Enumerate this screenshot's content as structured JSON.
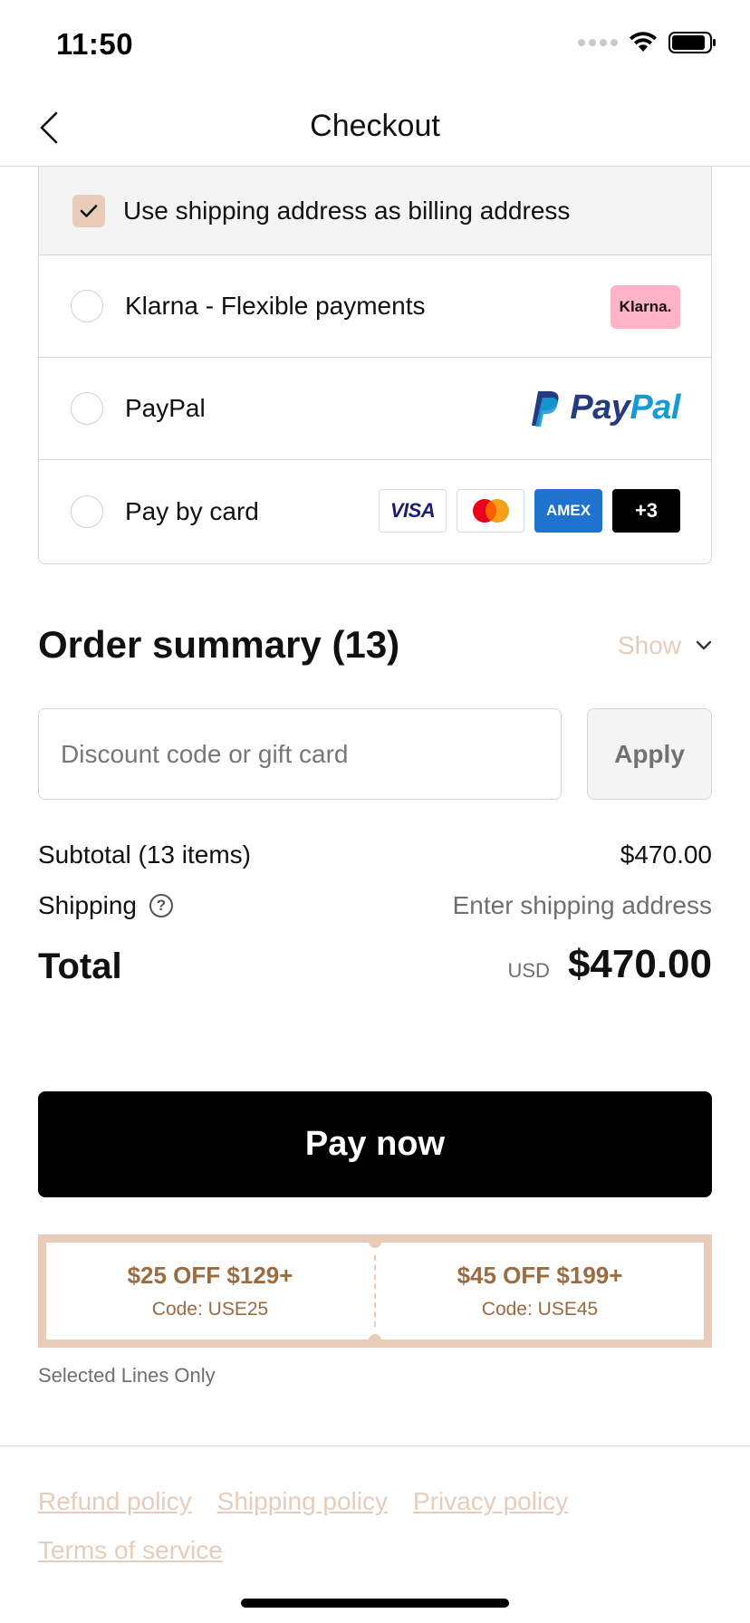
{
  "status_bar": {
    "time": "11:50"
  },
  "nav": {
    "title": "Checkout"
  },
  "payment": {
    "billing_label": "Use shipping address as billing address",
    "billing_checked": true,
    "options": [
      {
        "label": "Klarna - Flexible payments",
        "badge": "Klarna."
      },
      {
        "label": "PayPal",
        "logo_pay": "Pay",
        "logo_pal": "Pal"
      },
      {
        "label": "Pay by card",
        "cards": [
          "VISA",
          "mastercard",
          "AMEX",
          "+3"
        ]
      }
    ]
  },
  "summary": {
    "title": "Order summary (13)",
    "show_label": "Show",
    "discount_placeholder": "Discount code or gift card",
    "apply_label": "Apply",
    "subtotal_label": "Subtotal (13 items)",
    "subtotal_value": "$470.00",
    "shipping_label": "Shipping",
    "shipping_value": "Enter shipping address",
    "total_label": "Total",
    "currency": "USD",
    "total_value": "$470.00"
  },
  "pay_now_label": "Pay now",
  "coupons": [
    {
      "title": "$25 OFF $129+",
      "code": "Code: USE25"
    },
    {
      "title": "$45 OFF $199+",
      "code": "Code: USE45"
    }
  ],
  "coupon_note": "Selected Lines Only",
  "footer_links": [
    "Refund policy",
    "Shipping policy",
    "Privacy policy",
    "Terms of service"
  ],
  "colors": {
    "accent": "#e8cbb8",
    "coupon_text": "#9c6b3f",
    "link": "#e6cdbb",
    "klarna_pink": "#ffb3c7",
    "paypal_dark": "#253b80",
    "paypal_light": "#179bd7",
    "amex_blue": "#1f72cd"
  }
}
